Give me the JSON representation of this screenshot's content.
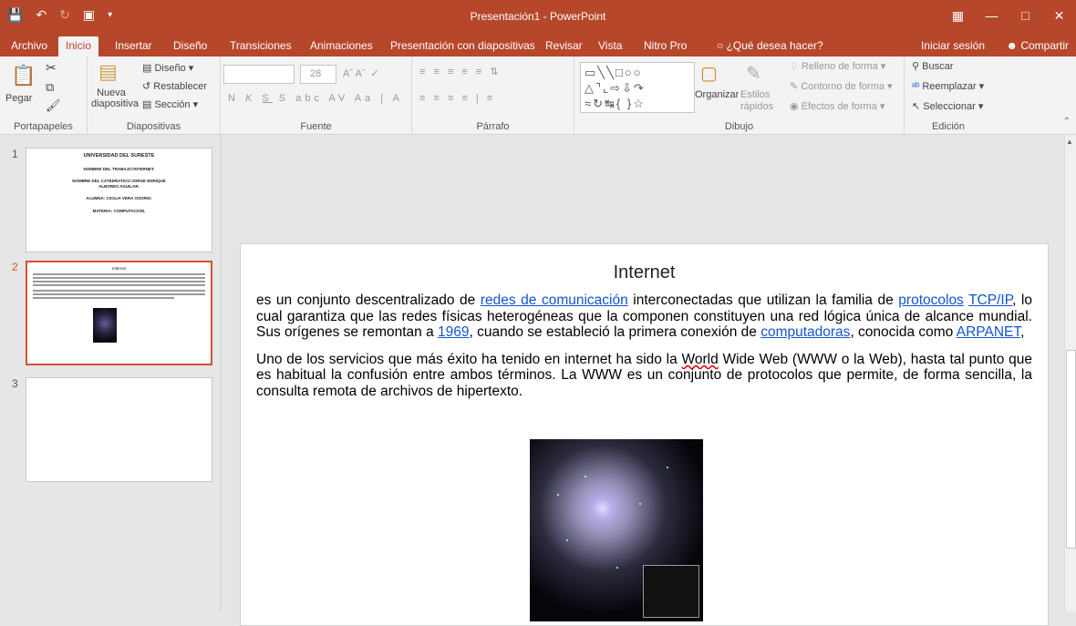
{
  "window": {
    "title": "Presentación1 - PowerPoint"
  },
  "tabs": [
    "Archivo",
    "Inicio",
    "Insertar",
    "Diseño",
    "Transiciones",
    "Animaciones",
    "Presentación con diapositivas",
    "Revisar",
    "Vista",
    "Nitro Pro",
    "¿Qué desea hacer?"
  ],
  "account": {
    "signin": "Iniciar sesión",
    "share": "Compartir"
  },
  "ribbon": {
    "groups": {
      "clipboard": "Portapapeles",
      "slides": "Diapositivas",
      "font": "Fuente",
      "paragraph": "Párrafo",
      "drawing": "Dibujo",
      "editing": "Edición"
    },
    "paste": "Pegar",
    "new_slide": "Nueva diapositiva",
    "layout": "Diseño",
    "reset": "Restablecer",
    "section": "Sección",
    "font_size": "28",
    "arrange": "Organizar",
    "quick_styles": "Estilos rápidos",
    "shape_fill": "Relleno de forma",
    "shape_outline": "Contorno de forma",
    "shape_effects": "Efectos de forma",
    "find": "Buscar",
    "replace": "Reemplazar",
    "select": "Seleccionar"
  },
  "thumbnails": [
    {
      "number": "1",
      "lines": [
        "UNIVERSIDAD DEL SURESTE",
        "NOMBRE DEL TRABAJO:INTERNET.",
        "NOMBRE DEL CATEDRATICO:JORGE ENRIQUE",
        "ALBORES AGUILAR.",
        "ALUMNA: CICILIA VERA OSORIO.",
        "MATERIA: COMPUTACION."
      ]
    },
    {
      "number": "2",
      "title": "Internet"
    },
    {
      "number": "3"
    }
  ],
  "slide": {
    "title": "Internet",
    "p1": {
      "t1": "es un conjunto descentralizado de ",
      "l1": "redes de comunicación",
      "t2": " interconectadas que utilizan la familia de ",
      "l2": "protocolos",
      "t3": " ",
      "l3": "TCP/IP",
      "t4": ", lo cual garantiza que las redes físicas heterogéneas que la componen constituyen una red lógica única de alcance mundial. Sus orígenes se remontan a ",
      "l4": "1969",
      "t5": ", cuando se estableció la primera conexión de ",
      "l5": "computadoras",
      "t6": ", conocida como ",
      "l6": "ARPANET",
      "t7": ","
    },
    "p2": {
      "t1": "Uno de los servicios que más éxito ha tenido en internet ha sido la ",
      "w": "World",
      "t2": " Wide Web (WWW o la Web), hasta tal punto que es habitual la confusión entre ambos términos. La WWW es un conjunto de protocolos que permite, de forma sencilla, la consulta remota de archivos de hipertexto."
    }
  }
}
